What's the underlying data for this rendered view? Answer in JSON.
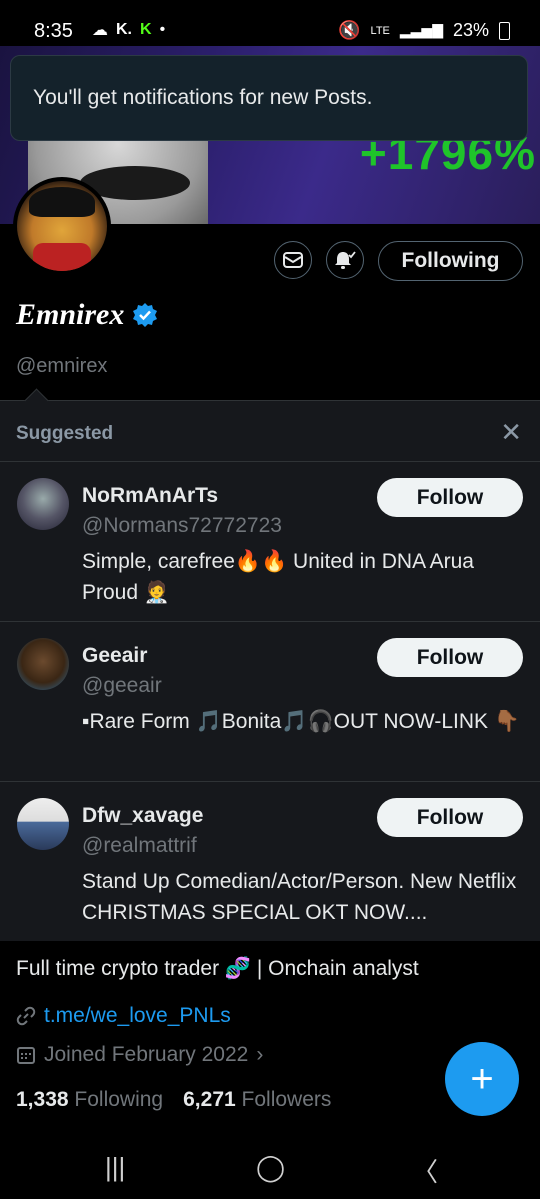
{
  "status_bar": {
    "time": "8:35",
    "left_icons": [
      "cloud-icon",
      "k-icon",
      "kick-icon",
      "dot"
    ],
    "lte": "LTE",
    "battery": "23%",
    "colors": {
      "kick": "#53fc18"
    }
  },
  "banner": {
    "gain_text": "+1796%",
    "gain_color": "#1fc42a"
  },
  "toast": {
    "text": "You'll get notifications for new Posts."
  },
  "profile": {
    "display_name": "Emnirex",
    "handle": "@emnirex",
    "following_button": "Following",
    "bio": "Full time crypto trader 🧬 | Onchain analyst",
    "link": "t.me/we_love_PNLs",
    "joined": "Joined February 2022",
    "following_count": "1,338",
    "following_label": "Following",
    "followers_count": "6,271",
    "followers_label": "Followers",
    "accent": "#1d9bf0"
  },
  "suggested": {
    "title": "Suggested",
    "items": [
      {
        "name": "NoRmAnArTs",
        "handle": "@Normans72772723",
        "bio": "Simple, carefree🔥🔥  United in DNA Arua  Proud 🧑‍⚕️",
        "follow_label": "Follow"
      },
      {
        "name": "Geeair",
        "handle": "@geeair",
        "bio": "▪Rare Form 🎵Bonita🎵🎧OUT NOW-LINK 👇🏾",
        "follow_label": "Follow"
      },
      {
        "name": "Dfw_xavage",
        "handle": "@realmattrif",
        "bio": "Stand Up Comedian/Actor/Person. New Netflix CHRISTMAS SPECIAL OKT NOW....",
        "follow_label": "Follow"
      }
    ]
  },
  "fab": {
    "label": "+"
  }
}
